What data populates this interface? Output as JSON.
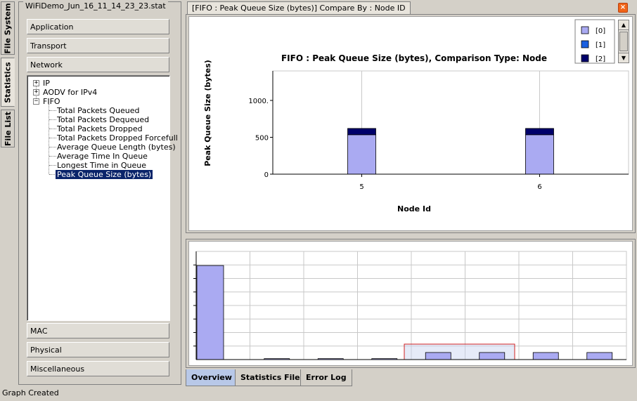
{
  "side_tabs": [
    "File System",
    "Statistics",
    "File List"
  ],
  "left_panel": {
    "title": "WiFiDemo_Jun_16_11_14_23_23.stat",
    "categories_top": [
      "Application",
      "Transport",
      "Network"
    ],
    "tree": {
      "top_nodes": [
        "IP",
        "AODV for IPv4",
        "FIFO"
      ],
      "expand_symbols": [
        "+",
        "+",
        "−"
      ],
      "fifo_children": [
        "Total Packets Queued",
        "Total Packets Dequeued",
        "Total Packets Dropped",
        "Total Packets Dropped Forcefull",
        "Average Queue Length (bytes)",
        "Average Time In Queue",
        "Longest Time in Queue",
        "Peak Queue Size (bytes)"
      ],
      "selected_index": 7
    },
    "categories_bottom": [
      "MAC",
      "Physical",
      "Miscellaneous"
    ]
  },
  "document_tab": "[FIFO :  Peak Queue Size (bytes)] Compare By : Node ID",
  "close_symbol": "×",
  "chart_data": {
    "type": "bar",
    "stacked": true,
    "title": "FIFO :  Peak Queue Size (bytes), Comparison Type: Node",
    "xlabel": "Node Id",
    "ylabel": "Peak Queue Size (bytes)",
    "categories": [
      "5",
      "6"
    ],
    "series": [
      {
        "name": "[0]",
        "values": [
          535,
          535
        ]
      },
      {
        "name": "[1]",
        "values": [
          0,
          0
        ]
      },
      {
        "name": "[2]",
        "values": [
          85,
          85
        ]
      }
    ],
    "ylim": [
      0,
      1400
    ],
    "yticks": [
      0,
      500,
      1000
    ],
    "ytick_labels": [
      "0",
      "500",
      "1000."
    ],
    "grid": true,
    "legend_placement": "top-right",
    "colors": [
      "#aaaaf2",
      "#1a5fe0",
      "#00006a"
    ]
  },
  "overview_data": {
    "values": [
      1000,
      10,
      10,
      10,
      75,
      75,
      75,
      75
    ],
    "max": 1150,
    "selection": [
      4,
      5
    ],
    "bar_color": "#aaaaf2",
    "selection_color": "#d02020"
  },
  "bottom_tabs": [
    "Overview",
    "Statistics File",
    "Error Log"
  ],
  "status": "Graph Created"
}
